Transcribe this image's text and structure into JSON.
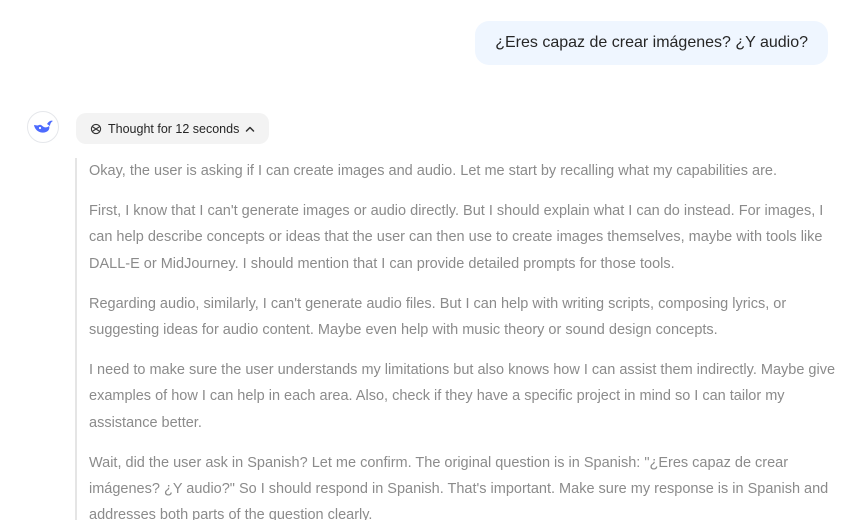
{
  "user_message": "¿Eres capaz de crear imágenes? ¿Y audio?",
  "assistant": {
    "avatar_icon": "deepseek-whale-icon",
    "thought_toggle_label": "Thought for 12 seconds",
    "thought_paragraphs": [
      "Okay, the user is asking if I can create images and audio. Let me start by recalling what my capabilities are.",
      "First, I know that I can't generate images or audio directly. But I should explain what I can do instead. For images, I can help describe concepts or ideas that the user can then use to create images themselves, maybe with tools like DALL-E or MidJourney. I should mention that I can provide detailed prompts for those tools.",
      "Regarding audio, similarly, I can't generate audio files. But I can help with writing scripts, composing lyrics, or suggesting ideas for audio content. Maybe even help with music theory or sound design concepts.",
      "I need to make sure the user understands my limitations but also knows how I can assist them indirectly. Maybe give examples of how I can help in each area. Also, check if they have a specific project in mind so I can tailor my assistance better.",
      "Wait, did the user ask in Spanish? Let me confirm. The original question is in Spanish: \"¿Eres capaz de crear imágenes? ¿Y audio?\" So I should respond in Spanish. That's important. Make sure my response is in Spanish and addresses both parts of the question clearly."
    ]
  },
  "colors": {
    "user_bubble_bg": "#eff6ff",
    "brand_blue": "#4d6bfe",
    "thinking_text": "#8b8b8b"
  }
}
